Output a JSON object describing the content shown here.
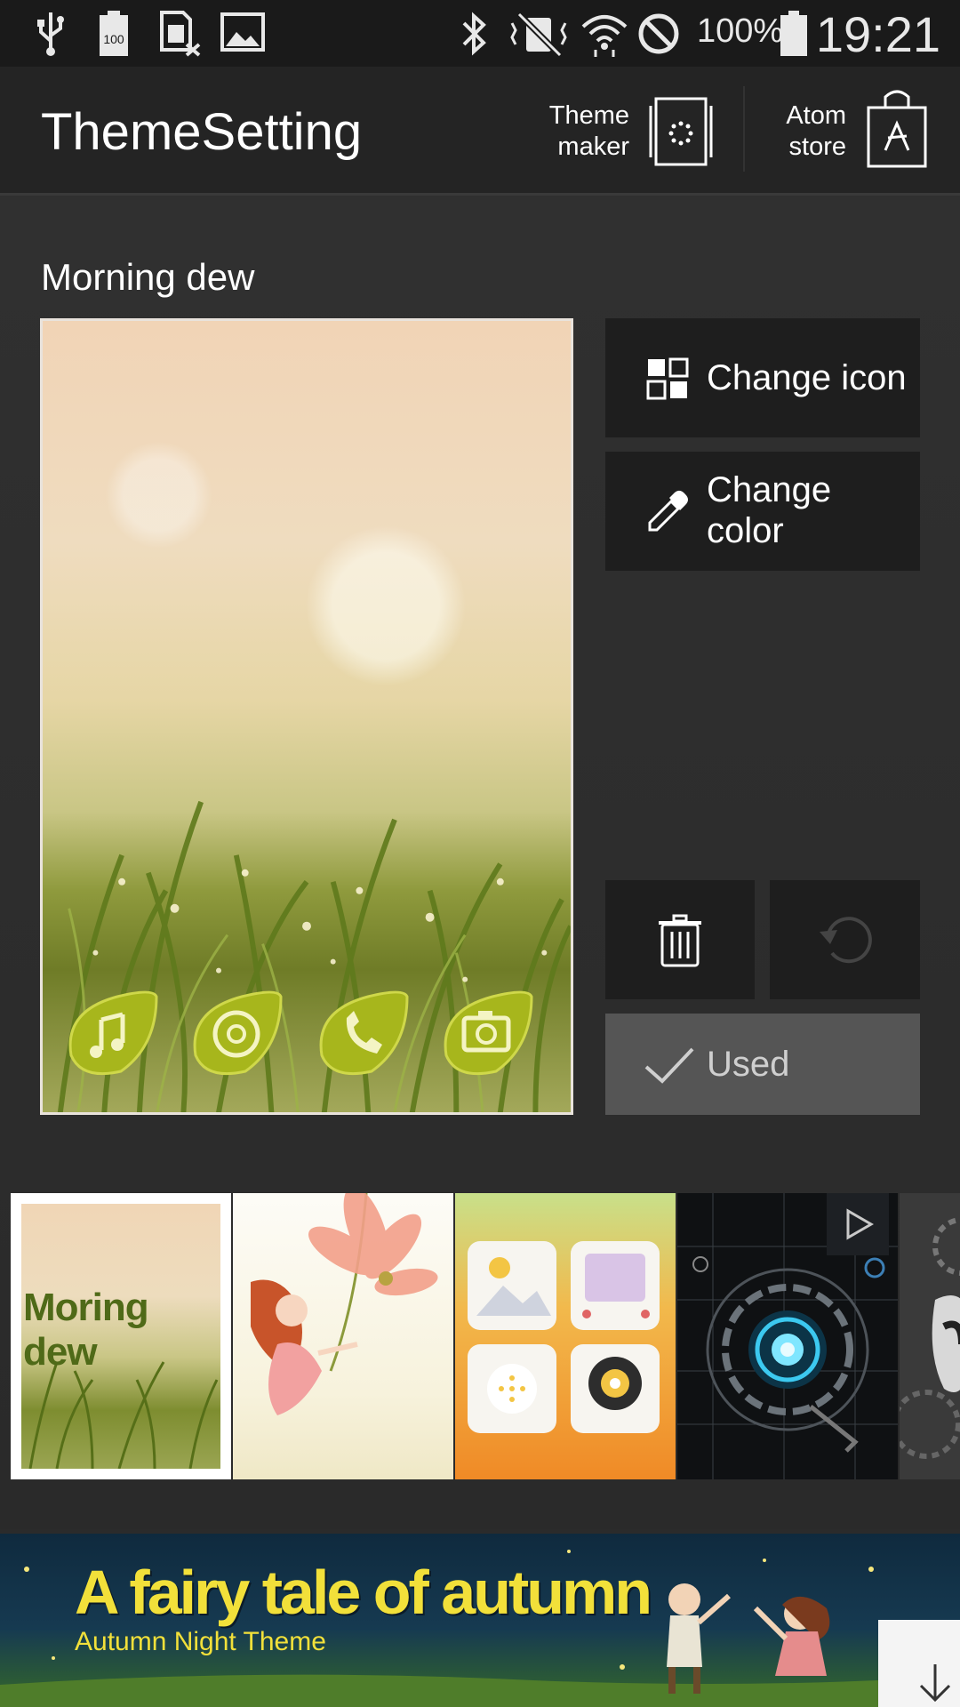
{
  "status_bar": {
    "icons": [
      "usb-icon",
      "battery-100-icon",
      "sim-card-icon",
      "image-icon",
      "bluetooth-icon",
      "mute-icon",
      "wifi-icon",
      "blocked-icon"
    ],
    "battery_percent": "100%",
    "time": "19:21"
  },
  "action_bar": {
    "title": "ThemeSetting",
    "theme_maker_label": "Theme\nmaker",
    "atom_store_label": "Atom\nstore"
  },
  "theme": {
    "name": "Morning dew",
    "dock_icons": [
      "music-icon",
      "browser-icon",
      "phone-icon",
      "camera-icon"
    ]
  },
  "buttons": {
    "change_icon": "Change icon",
    "change_color": "Change\ncolor",
    "used": "Used"
  },
  "thumbnails": [
    {
      "name": "morning-dew",
      "label": "Moring dew",
      "selected": true
    },
    {
      "name": "fairy-flower",
      "label": "",
      "selected": false
    },
    {
      "name": "gallery-icons",
      "label": "",
      "selected": false
    },
    {
      "name": "tech-circle",
      "label": "",
      "selected": false
    },
    {
      "name": "gear-robot",
      "label": "",
      "selected": false
    }
  ],
  "banner": {
    "title": "A fairy tale of autumn",
    "subtitle": "Autumn Night Theme"
  },
  "colors": {
    "background": "#2b2b2b",
    "button": "#1e1e1e",
    "used_button": "#555555",
    "banner_text": "#f2e03a"
  }
}
